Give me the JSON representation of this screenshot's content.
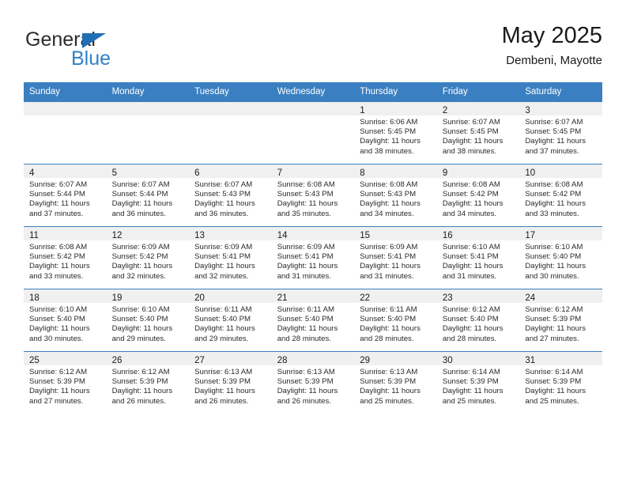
{
  "brand": {
    "name_part1": "General",
    "name_part2": "Blue",
    "accent_color": "#2f81c9",
    "triangle_color": "#1f6fb5"
  },
  "header": {
    "month_title": "May 2025",
    "location": "Dembeni, Mayotte"
  },
  "calendar": {
    "header_bg": "#3a7fc1",
    "daynum_band_bg": "#f0f0f0",
    "weekdays": [
      "Sunday",
      "Monday",
      "Tuesday",
      "Wednesday",
      "Thursday",
      "Friday",
      "Saturday"
    ],
    "weeks": [
      [
        {
          "empty": true
        },
        {
          "empty": true
        },
        {
          "empty": true
        },
        {
          "empty": true
        },
        {
          "day": "1",
          "sunrise": "Sunrise: 6:06 AM",
          "sunset": "Sunset: 5:45 PM",
          "daylight_line1": "Daylight: 11 hours",
          "daylight_line2": "and 38 minutes."
        },
        {
          "day": "2",
          "sunrise": "Sunrise: 6:07 AM",
          "sunset": "Sunset: 5:45 PM",
          "daylight_line1": "Daylight: 11 hours",
          "daylight_line2": "and 38 minutes."
        },
        {
          "day": "3",
          "sunrise": "Sunrise: 6:07 AM",
          "sunset": "Sunset: 5:45 PM",
          "daylight_line1": "Daylight: 11 hours",
          "daylight_line2": "and 37 minutes."
        }
      ],
      [
        {
          "day": "4",
          "sunrise": "Sunrise: 6:07 AM",
          "sunset": "Sunset: 5:44 PM",
          "daylight_line1": "Daylight: 11 hours",
          "daylight_line2": "and 37 minutes."
        },
        {
          "day": "5",
          "sunrise": "Sunrise: 6:07 AM",
          "sunset": "Sunset: 5:44 PM",
          "daylight_line1": "Daylight: 11 hours",
          "daylight_line2": "and 36 minutes."
        },
        {
          "day": "6",
          "sunrise": "Sunrise: 6:07 AM",
          "sunset": "Sunset: 5:43 PM",
          "daylight_line1": "Daylight: 11 hours",
          "daylight_line2": "and 36 minutes."
        },
        {
          "day": "7",
          "sunrise": "Sunrise: 6:08 AM",
          "sunset": "Sunset: 5:43 PM",
          "daylight_line1": "Daylight: 11 hours",
          "daylight_line2": "and 35 minutes."
        },
        {
          "day": "8",
          "sunrise": "Sunrise: 6:08 AM",
          "sunset": "Sunset: 5:43 PM",
          "daylight_line1": "Daylight: 11 hours",
          "daylight_line2": "and 34 minutes."
        },
        {
          "day": "9",
          "sunrise": "Sunrise: 6:08 AM",
          "sunset": "Sunset: 5:42 PM",
          "daylight_line1": "Daylight: 11 hours",
          "daylight_line2": "and 34 minutes."
        },
        {
          "day": "10",
          "sunrise": "Sunrise: 6:08 AM",
          "sunset": "Sunset: 5:42 PM",
          "daylight_line1": "Daylight: 11 hours",
          "daylight_line2": "and 33 minutes."
        }
      ],
      [
        {
          "day": "11",
          "sunrise": "Sunrise: 6:08 AM",
          "sunset": "Sunset: 5:42 PM",
          "daylight_line1": "Daylight: 11 hours",
          "daylight_line2": "and 33 minutes."
        },
        {
          "day": "12",
          "sunrise": "Sunrise: 6:09 AM",
          "sunset": "Sunset: 5:42 PM",
          "daylight_line1": "Daylight: 11 hours",
          "daylight_line2": "and 32 minutes."
        },
        {
          "day": "13",
          "sunrise": "Sunrise: 6:09 AM",
          "sunset": "Sunset: 5:41 PM",
          "daylight_line1": "Daylight: 11 hours",
          "daylight_line2": "and 32 minutes."
        },
        {
          "day": "14",
          "sunrise": "Sunrise: 6:09 AM",
          "sunset": "Sunset: 5:41 PM",
          "daylight_line1": "Daylight: 11 hours",
          "daylight_line2": "and 31 minutes."
        },
        {
          "day": "15",
          "sunrise": "Sunrise: 6:09 AM",
          "sunset": "Sunset: 5:41 PM",
          "daylight_line1": "Daylight: 11 hours",
          "daylight_line2": "and 31 minutes."
        },
        {
          "day": "16",
          "sunrise": "Sunrise: 6:10 AM",
          "sunset": "Sunset: 5:41 PM",
          "daylight_line1": "Daylight: 11 hours",
          "daylight_line2": "and 31 minutes."
        },
        {
          "day": "17",
          "sunrise": "Sunrise: 6:10 AM",
          "sunset": "Sunset: 5:40 PM",
          "daylight_line1": "Daylight: 11 hours",
          "daylight_line2": "and 30 minutes."
        }
      ],
      [
        {
          "day": "18",
          "sunrise": "Sunrise: 6:10 AM",
          "sunset": "Sunset: 5:40 PM",
          "daylight_line1": "Daylight: 11 hours",
          "daylight_line2": "and 30 minutes."
        },
        {
          "day": "19",
          "sunrise": "Sunrise: 6:10 AM",
          "sunset": "Sunset: 5:40 PM",
          "daylight_line1": "Daylight: 11 hours",
          "daylight_line2": "and 29 minutes."
        },
        {
          "day": "20",
          "sunrise": "Sunrise: 6:11 AM",
          "sunset": "Sunset: 5:40 PM",
          "daylight_line1": "Daylight: 11 hours",
          "daylight_line2": "and 29 minutes."
        },
        {
          "day": "21",
          "sunrise": "Sunrise: 6:11 AM",
          "sunset": "Sunset: 5:40 PM",
          "daylight_line1": "Daylight: 11 hours",
          "daylight_line2": "and 28 minutes."
        },
        {
          "day": "22",
          "sunrise": "Sunrise: 6:11 AM",
          "sunset": "Sunset: 5:40 PM",
          "daylight_line1": "Daylight: 11 hours",
          "daylight_line2": "and 28 minutes."
        },
        {
          "day": "23",
          "sunrise": "Sunrise: 6:12 AM",
          "sunset": "Sunset: 5:40 PM",
          "daylight_line1": "Daylight: 11 hours",
          "daylight_line2": "and 28 minutes."
        },
        {
          "day": "24",
          "sunrise": "Sunrise: 6:12 AM",
          "sunset": "Sunset: 5:39 PM",
          "daylight_line1": "Daylight: 11 hours",
          "daylight_line2": "and 27 minutes."
        }
      ],
      [
        {
          "day": "25",
          "sunrise": "Sunrise: 6:12 AM",
          "sunset": "Sunset: 5:39 PM",
          "daylight_line1": "Daylight: 11 hours",
          "daylight_line2": "and 27 minutes."
        },
        {
          "day": "26",
          "sunrise": "Sunrise: 6:12 AM",
          "sunset": "Sunset: 5:39 PM",
          "daylight_line1": "Daylight: 11 hours",
          "daylight_line2": "and 26 minutes."
        },
        {
          "day": "27",
          "sunrise": "Sunrise: 6:13 AM",
          "sunset": "Sunset: 5:39 PM",
          "daylight_line1": "Daylight: 11 hours",
          "daylight_line2": "and 26 minutes."
        },
        {
          "day": "28",
          "sunrise": "Sunrise: 6:13 AM",
          "sunset": "Sunset: 5:39 PM",
          "daylight_line1": "Daylight: 11 hours",
          "daylight_line2": "and 26 minutes."
        },
        {
          "day": "29",
          "sunrise": "Sunrise: 6:13 AM",
          "sunset": "Sunset: 5:39 PM",
          "daylight_line1": "Daylight: 11 hours",
          "daylight_line2": "and 25 minutes."
        },
        {
          "day": "30",
          "sunrise": "Sunrise: 6:14 AM",
          "sunset": "Sunset: 5:39 PM",
          "daylight_line1": "Daylight: 11 hours",
          "daylight_line2": "and 25 minutes."
        },
        {
          "day": "31",
          "sunrise": "Sunrise: 6:14 AM",
          "sunset": "Sunset: 5:39 PM",
          "daylight_line1": "Daylight: 11 hours",
          "daylight_line2": "and 25 minutes."
        }
      ]
    ]
  }
}
